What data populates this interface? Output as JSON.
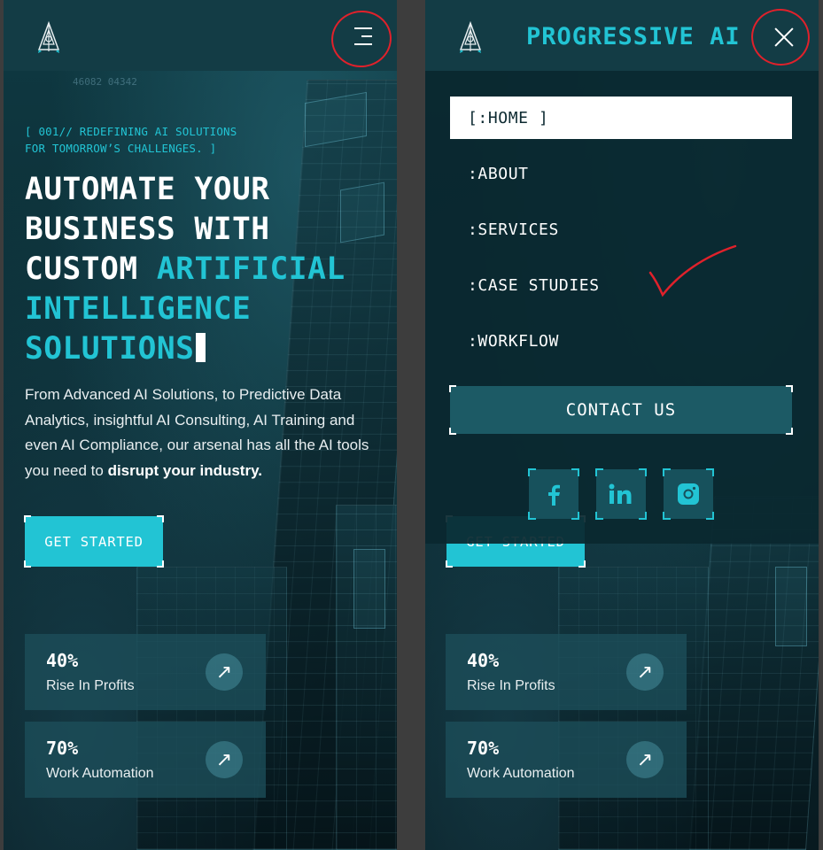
{
  "left_screen": {
    "tagline": "[ 001// REDEFINING AI SOLUTIONS\nFOR TOMORROW’S CHALLENGES. ]",
    "headline_white": "AUTOMATE YOUR BUSINESS WITH CUSTOM ",
    "headline_accent": "ARTIFICIAL INTELLIGENCE SOLUTIONS",
    "body_text": "From Advanced AI Solutions, to Predictive Data Analytics, insightful AI Consulting, AI Training and even AI Compliance, our arsenal has all the AI tools you need to ",
    "body_text_bold": "disrupt your industry.",
    "cta_label": "GET STARTED",
    "deco_text": "46082 04342"
  },
  "stats": [
    {
      "value": "40%",
      "label": "Rise In Profits",
      "arrow": "↗"
    },
    {
      "value": "70%",
      "label": "Work Automation",
      "arrow": "↗"
    }
  ],
  "right_screen": {
    "brand": "PROGRESSIVE AI",
    "menu_items": [
      "[:HOME ]",
      ":ABOUT",
      ":SERVICES",
      ":CASE STUDIES",
      ":WORKFLOW"
    ],
    "contact_label": "CONTACT US",
    "cta_partial": "GET STARTED",
    "socials": [
      "facebook-icon",
      "linkedin-icon",
      "instagram-icon"
    ]
  },
  "colors": {
    "accent": "#22c4d4",
    "annotation_red": "#e0212b",
    "header_bg": "#133c45"
  }
}
